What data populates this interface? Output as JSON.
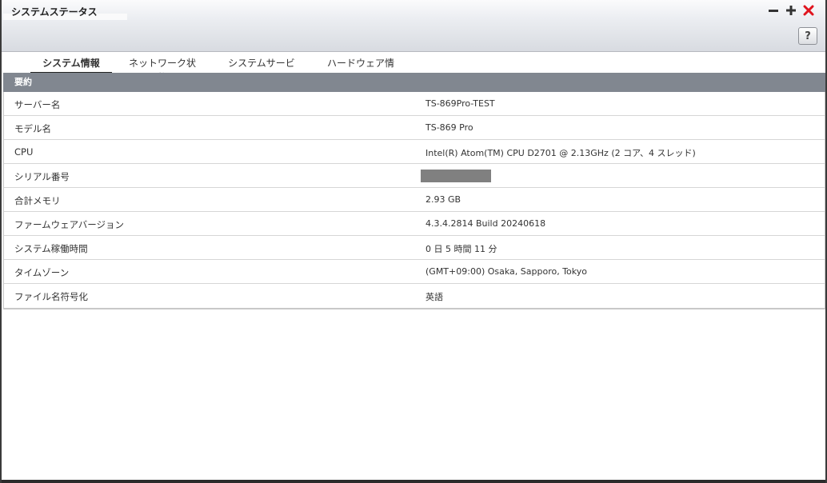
{
  "window": {
    "title": "システムステータス",
    "help_label": "?",
    "colors": {
      "close": "#e0141e",
      "control": "#333333",
      "section_header": "#818790"
    }
  },
  "tabs": [
    {
      "label": "システム情報",
      "active": true
    },
    {
      "label": "ネットワーク状態",
      "active": false
    },
    {
      "label": "システムサービス",
      "active": false
    },
    {
      "label": "ハードウェア情報",
      "active": false
    }
  ],
  "section": {
    "title": "要約"
  },
  "rows": [
    {
      "label": "サーバー名",
      "value": "TS-869Pro-TEST"
    },
    {
      "label": "モデル名",
      "value": "TS-869 Pro"
    },
    {
      "label": "CPU",
      "value": "Intel(R) Atom(TM) CPU D2701 @ 2.13GHz (2 コア、4 スレッド)"
    },
    {
      "label": "シリアル番号",
      "value": ""
    },
    {
      "label": "合計メモリ",
      "value": "2.93 GB"
    },
    {
      "label": "ファームウェアバージョン",
      "value": "4.3.4.2814 Build 20240618"
    },
    {
      "label": "システム稼働時間",
      "value": "0 日 5 時間 11 分"
    },
    {
      "label": "タイムゾーン",
      "value": "(GMT+09:00) Osaka, Sapporo, Tokyo"
    },
    {
      "label": "ファイル名符号化",
      "value": "英語"
    }
  ]
}
